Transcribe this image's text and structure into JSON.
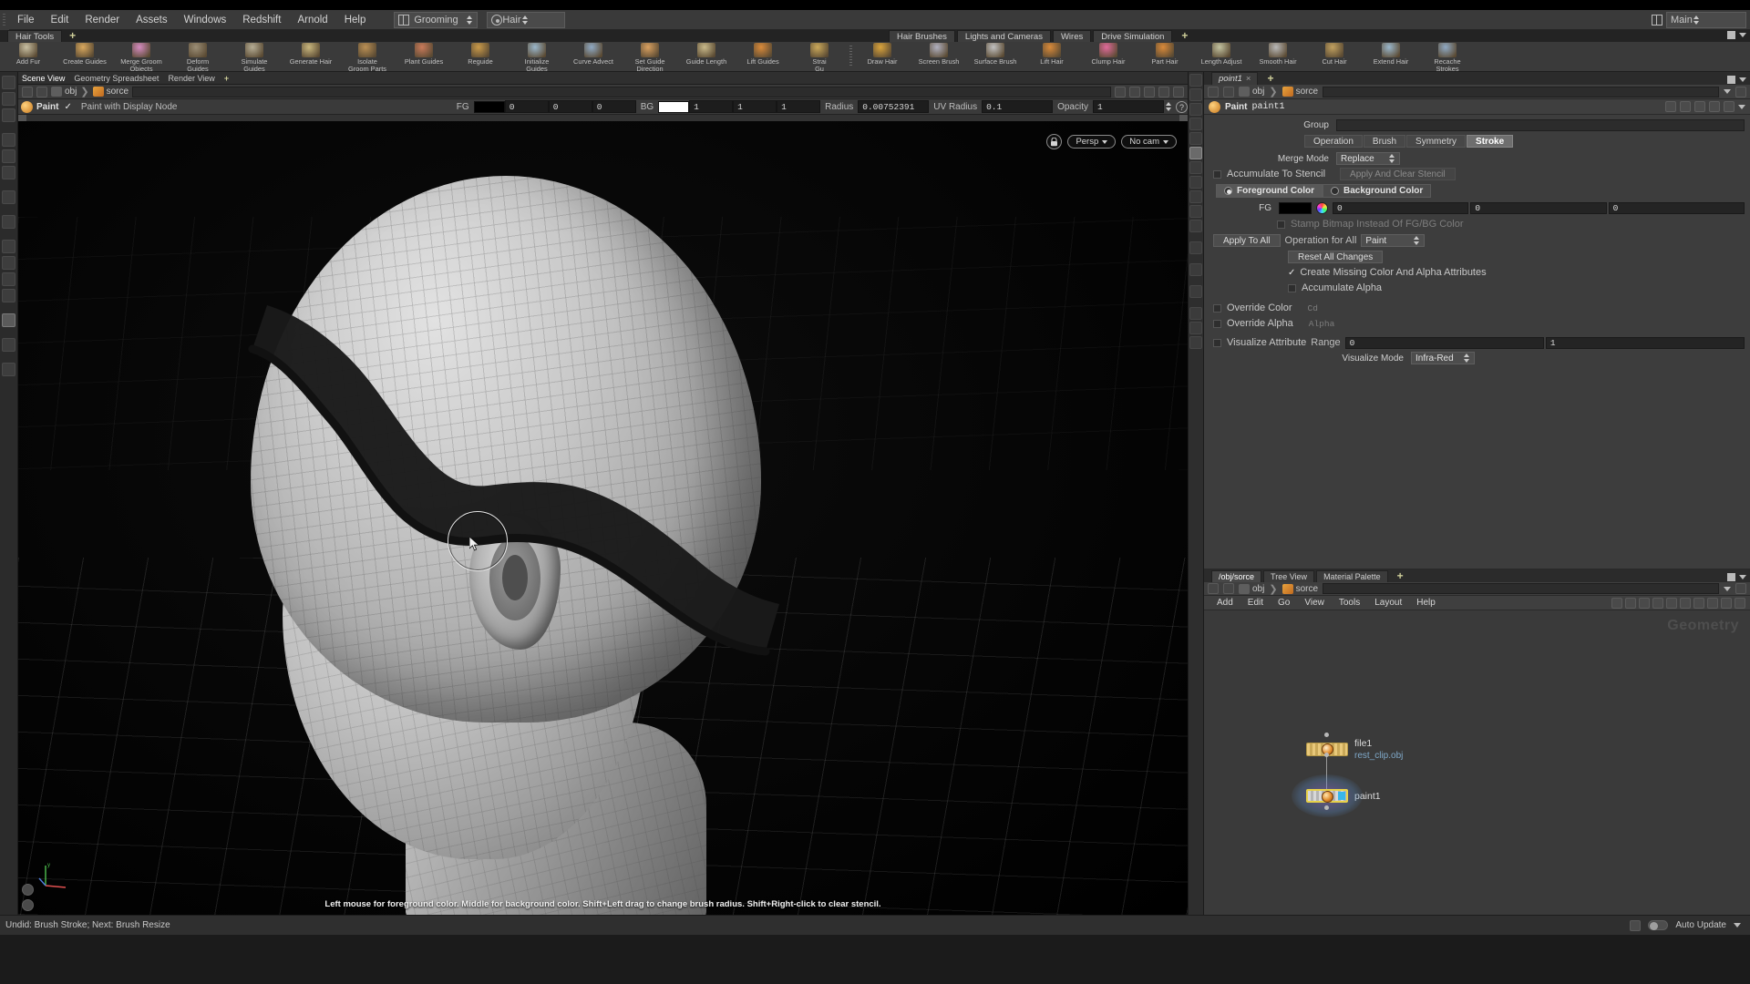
{
  "menu": {
    "items": [
      "File",
      "Edit",
      "Render",
      "Assets",
      "Windows",
      "Redshift",
      "Arnold",
      "Help"
    ],
    "desktop": "Grooming",
    "context": "Hair",
    "main_selector": "Main"
  },
  "shelf": {
    "tabs": [
      "Hair Tools"
    ],
    "add_label": "+",
    "tools": [
      {
        "label": "Add Fur",
        "icon": "sphere-icon",
        "color": "#c8bfa2"
      },
      {
        "label": "Create Guides",
        "icon": "guides-icon",
        "color": "#d9a85e"
      },
      {
        "label": "Merge Groom\nObjects",
        "icon": "merge-icon",
        "color": "#d48bc0"
      },
      {
        "label": "Deform\nGuides",
        "icon": "deform-icon",
        "color": "#9b8e76"
      },
      {
        "label": "Simulate\nGuides",
        "icon": "simulate-icon",
        "color": "#b5ad95"
      },
      {
        "label": "Generate Hair",
        "icon": "generate-icon",
        "color": "#c9b77e"
      },
      {
        "label": "Isolate\nGroom Parts",
        "icon": "isolate-icon",
        "color": "#b98f54"
      },
      {
        "label": "Plant Guides",
        "icon": "plant-icon",
        "color": "#c97a5a"
      },
      {
        "label": "Reguide",
        "icon": "reguide-icon",
        "color": "#c99a4a"
      },
      {
        "label": "Initialize\nGuides",
        "icon": "initialize-icon",
        "color": "#9ab7cc"
      },
      {
        "label": "Curve Advect",
        "icon": "curve-icon",
        "color": "#8fa9c4"
      },
      {
        "label": "Set Guide\nDirection",
        "icon": "direction-icon",
        "color": "#d9a060"
      },
      {
        "label": "Guide Length",
        "icon": "length-icon",
        "color": "#c8b98a"
      },
      {
        "label": "Lift Guides",
        "icon": "lift-icon",
        "color": "#d98a3a"
      },
      {
        "label": "Strai\nGu",
        "icon": "straighten-icon",
        "color": "#caa85a"
      }
    ],
    "tools2": [
      {
        "label": "Draw Hair",
        "icon": "draw-hair-icon",
        "color": "#d9a33c"
      },
      {
        "label": "Screen Brush",
        "icon": "screen-brush-icon",
        "color": "#b0b0c0"
      },
      {
        "label": "Surface Brush",
        "icon": "surface-brush-icon",
        "color": "#c0c0c0"
      },
      {
        "label": "Lift Hair",
        "icon": "lift-hair-icon",
        "color": "#d98a3a"
      },
      {
        "label": "Clump Hair",
        "icon": "clump-hair-icon",
        "color": "#e06a9a"
      },
      {
        "label": "Part Hair",
        "icon": "part-hair-icon",
        "color": "#d98a3a"
      },
      {
        "label": "Length Adjust",
        "icon": "length-adjust-icon",
        "color": "#c2c2a0"
      },
      {
        "label": "Smooth Hair",
        "icon": "smooth-hair-icon",
        "color": "#b8b8b8"
      },
      {
        "label": "Cut Hair",
        "icon": "cut-hair-icon",
        "color": "#c0a060"
      },
      {
        "label": "Extend Hair",
        "icon": "extend-hair-icon",
        "color": "#9ab7cc"
      },
      {
        "label": "Recache\nStrokes",
        "icon": "recache-icon",
        "color": "#8fa9c4"
      }
    ],
    "tabs2": [
      "Hair Brushes",
      "Lights and Cameras",
      "Wires",
      "Drive Simulation"
    ]
  },
  "viewport": {
    "panel_tabs": [
      "Scene View",
      "Geometry Spreadsheet",
      "Render View"
    ],
    "breadcrumb": [
      "obj",
      "sorce"
    ],
    "toolbar": {
      "tool_name": "Paint",
      "display_node": "Paint with Display Node",
      "fg_label": "FG",
      "fg_values": [
        "0",
        "0",
        "0"
      ],
      "fg_color": "#000000",
      "bg_label": "BG",
      "bg_values": [
        "1",
        "1",
        "1"
      ],
      "bg_color": "#ffffff",
      "radius_label": "Radius",
      "radius_value": "0.00752391",
      "uv_radius_label": "UV Radius",
      "uv_radius_value": "0.1",
      "opacity_label": "Opacity",
      "opacity_value": "1"
    },
    "overlay": {
      "view_mode": "Persp",
      "camera": "No cam",
      "lock_icon": "lock-icon"
    },
    "hint": "Left mouse for foreground color. Middle for background color. Shift+Left drag to change brush radius. Shift+Right-click to clear stencil."
  },
  "parameters": {
    "tab_name": "point1",
    "breadcrumb": [
      "obj",
      "sorce"
    ],
    "node_type": "Paint",
    "node_name": "paint1",
    "group_label": "Group",
    "group_value": "",
    "tabs": [
      "Operation",
      "Brush",
      "Symmetry",
      "Stroke"
    ],
    "selected_tab": "Stroke",
    "merge_mode_label": "Merge Mode",
    "merge_mode_value": "Replace",
    "accumulate_stencil_label": "Accumulate To Stencil",
    "apply_clear_stencil_label": "Apply And Clear Stencil",
    "foreground_color_label": "Foreground Color",
    "background_color_label": "Background Color",
    "fg_label": "FG",
    "fg_color": "#000000",
    "fg_values": [
      "0",
      "0",
      "0"
    ],
    "stamp_bitmap_label": "Stamp Bitmap Instead Of FG/BG Color",
    "apply_to_all_label": "Apply To All",
    "operation_for_all_label": "Operation for All",
    "operation_for_all_value": "Paint",
    "reset_all_label": "Reset All Changes",
    "create_missing_label": "Create Missing Color And Alpha Attributes",
    "accumulate_alpha_label": "Accumulate Alpha",
    "override_color_label": "Override Color",
    "override_color_value": "Cd",
    "override_alpha_label": "Override Alpha",
    "override_alpha_value": "Alpha",
    "visualize_attribute_label": "Visualize Attribute",
    "range_label": "Range",
    "range_values": [
      "0",
      "1"
    ],
    "visualize_mode_label": "Visualize Mode",
    "visualize_mode_value": "Infra-Red"
  },
  "network": {
    "tabs": [
      "/obj/sorce",
      "Tree View",
      "Material Palette"
    ],
    "selected_tab": "/obj/sorce",
    "add_label": "+",
    "breadcrumb": [
      "obj",
      "sorce"
    ],
    "menu": [
      "Add",
      "Edit",
      "Go",
      "View",
      "Tools",
      "Layout",
      "Help"
    ],
    "context_label": "Geometry",
    "nodes": [
      {
        "name": "file1",
        "subtitle": "rest_clip.obj",
        "type": "file"
      },
      {
        "name": "paint1",
        "subtitle": "",
        "type": "paint"
      }
    ]
  },
  "status": {
    "message": "Undid: Brush Stroke; Next: Brush Resize",
    "auto_update": "Auto Update"
  },
  "colors": {
    "accent_yellow": "#e8d24a",
    "node_blue": "#39b6e8",
    "link_blue": "#7fa8c8"
  }
}
